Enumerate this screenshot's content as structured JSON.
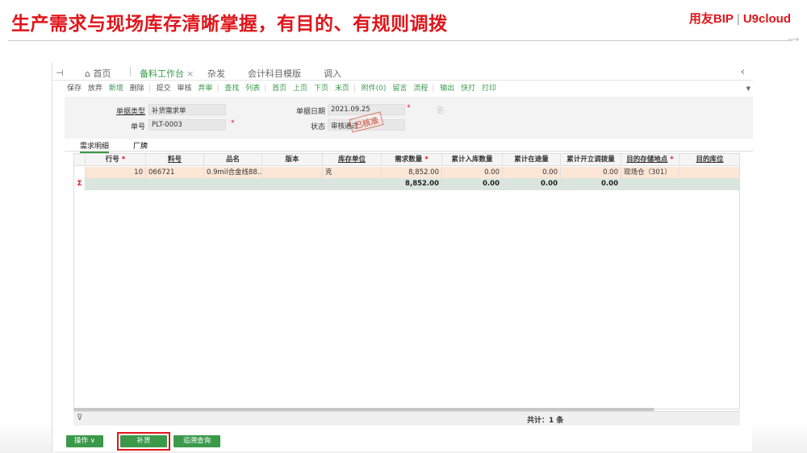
{
  "slide": {
    "title": "生产需求与现场库存清晰掌握，有目的、有规则调拨",
    "brand_left": "用友BIP",
    "brand_sep": "|",
    "brand_right": "U9cloud"
  },
  "tabs": [
    {
      "label": "首页"
    },
    {
      "label": "备料工作台",
      "active": true
    },
    {
      "label": "杂发"
    },
    {
      "label": "会计科目模版"
    },
    {
      "label": "调入"
    }
  ],
  "toolbar": {
    "items": [
      "保存",
      "放弃",
      "新增",
      "删除",
      "提交",
      "审核",
      "弃审",
      "查找",
      "列表",
      "首页",
      "上页",
      "下页",
      "末页",
      "附件(0)",
      "留言",
      "流程",
      "输出",
      "快打",
      "打印"
    ]
  },
  "form": {
    "doc_type_label": "单据类型",
    "doc_type_value": "补货需求单",
    "doc_no_label": "单号",
    "doc_no_value": "PLT-0003",
    "doc_date_label": "单据日期",
    "doc_date_value": "2021.09.25",
    "status_label": "状态",
    "status_value": "审核通过",
    "stamp_text": "已核准"
  },
  "subtabs": [
    "需求明细",
    "厂牌"
  ],
  "grid": {
    "columns": [
      "行号",
      "料号",
      "品名",
      "版本",
      "库存单位",
      "需求数量",
      "累计入库数量",
      "累计在途量",
      "累计开立调拨量",
      "目的存储地点",
      "目的库位"
    ],
    "row": {
      "line_no": "10",
      "item_code": "066721",
      "item_name": "0.9mil合金线88...",
      "version": "",
      "unit": "克",
      "demand_qty": "8,852.00",
      "cum_in_qty": "0.00",
      "cum_transit_qty": "0.00",
      "cum_transfer_qty": "0.00",
      "dest_location": "现场仓（301）",
      "dest_bin": ""
    },
    "sum_row": {
      "sigma": "Σ",
      "demand_qty": "8,852.00",
      "cum_in_qty": "0.00",
      "cum_transit_qty": "0.00",
      "cum_transfer_qty": "0.00"
    },
    "total_text": "共计：1 条"
  },
  "buttons": {
    "operate": "操作 ∨",
    "replenish": "补货",
    "trace": "追溯查询"
  }
}
